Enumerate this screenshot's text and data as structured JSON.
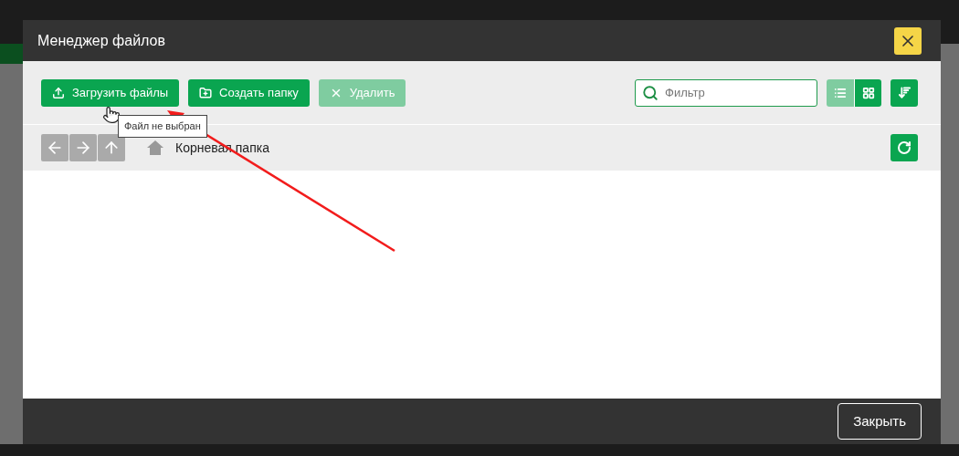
{
  "modal": {
    "title": "Менеджер файлов",
    "toolbar": {
      "buttons": [
        {
          "kind": "upload",
          "label": "Загрузить файлы",
          "disabled": false
        },
        {
          "kind": "folder",
          "label": "Создать папку",
          "disabled": false
        },
        {
          "kind": "delete",
          "label": "Удалить",
          "disabled": true
        }
      ],
      "filter": {
        "placeholder": "Фильтр"
      },
      "views": [
        {
          "kind": "list",
          "selected": true
        },
        {
          "kind": "grid",
          "selected": false
        }
      ]
    },
    "tooltip": "Файл не выбран",
    "navigation": {
      "buttons": [
        {
          "kind": "back",
          "disabled": true
        },
        {
          "kind": "forward",
          "disabled": true
        },
        {
          "kind": "up",
          "disabled": true
        }
      ],
      "path": "Корневая папка"
    },
    "footer_button": "Закрыть"
  }
}
